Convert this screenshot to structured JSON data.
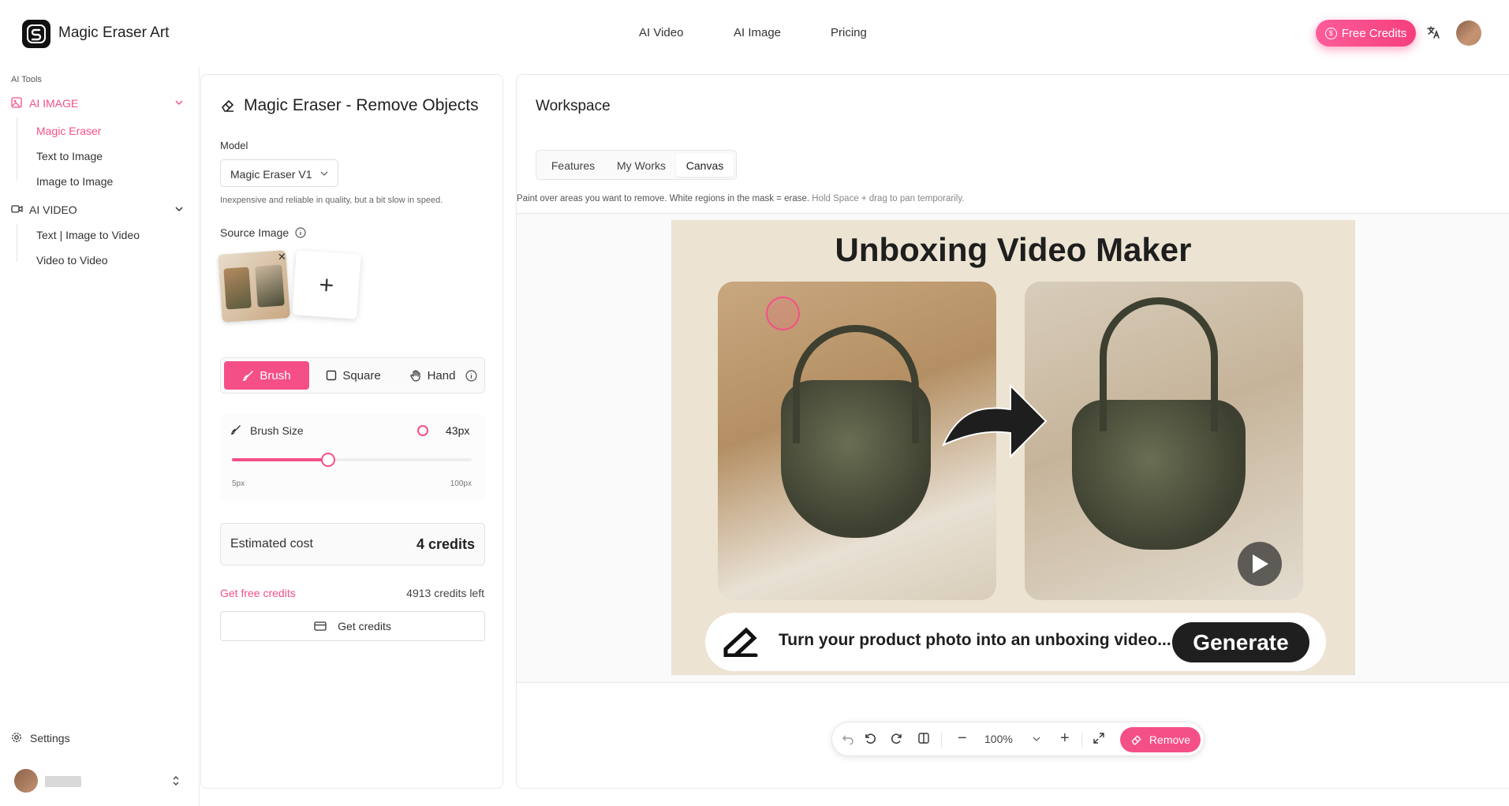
{
  "header": {
    "brand": "Magic Eraser Art",
    "nav": [
      "AI Video",
      "AI Image",
      "Pricing"
    ],
    "free_credits": "Free Credits"
  },
  "sidebar": {
    "section_label": "AI Tools",
    "groups": [
      {
        "label": "AI IMAGE",
        "items": [
          "Magic Eraser",
          "Text to Image",
          "Image to Image"
        ]
      },
      {
        "label": "AI VIDEO",
        "items": [
          "Text | Image to Video",
          "Video to Video"
        ]
      }
    ],
    "settings": "Settings"
  },
  "panel": {
    "title": "Magic Eraser - Remove Objects",
    "model_label": "Model",
    "model_value": "Magic Eraser V1",
    "model_hint": "Inexpensive and reliable in quality, but a bit slow in speed.",
    "source_label": "Source Image",
    "tools": [
      "Brush",
      "Square",
      "Hand"
    ],
    "brush_size_label": "Brush Size",
    "brush_size_value": "43px",
    "brush_fraction": 0.4,
    "brush_min": "5px",
    "brush_max": "100px",
    "cost_label": "Estimated cost",
    "cost_value": "4 credits",
    "get_free": "Get free credits",
    "credits_left": "4913 credits left",
    "get_credits": "Get credits"
  },
  "workspace": {
    "title": "Workspace",
    "tabs": [
      "Features",
      "My Works",
      "Canvas"
    ],
    "instructions": "Paint over areas you want to remove. White regions in the mask = erase.",
    "pan_hint": "Hold Space + drag to pan temporarily.",
    "image_title": "Unboxing Video Maker",
    "image_prompt": "Turn your product photo into an unboxing video...",
    "image_button": "Generate"
  },
  "toolbar": {
    "zoom": "100%",
    "remove": "Remove"
  },
  "colors": {
    "accent": "#f54f88",
    "text": "#222222"
  }
}
